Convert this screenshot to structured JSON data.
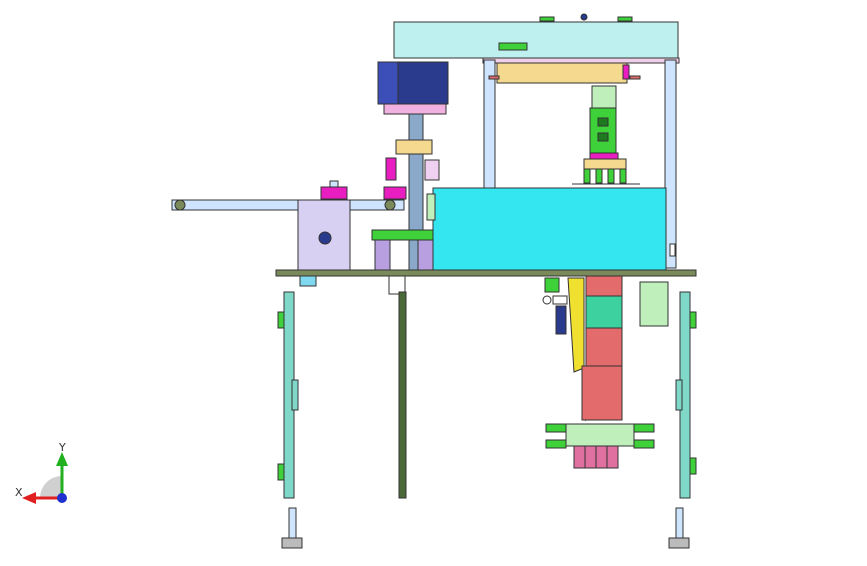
{
  "viewport": {
    "background": "#ffffff",
    "triad": {
      "x_label": "X",
      "y_label": "Y",
      "x_color": "#e02020",
      "y_color": "#20b020",
      "z_color": "#2030d0"
    }
  },
  "colors": {
    "outline": "#333333",
    "cyan_box": "#33e6f0",
    "top_plate": "#bff0f0",
    "tan_plate": "#f5d98e",
    "navy_motor": "#2a3a8c",
    "magenta": "#e91ec0",
    "green": "#3ed13a",
    "salmon": "#e36b6b",
    "lavender": "#d8d0f2",
    "olive_plate": "#7b8a5a",
    "leg_cyan": "#7fd8c8",
    "yellow": "#f0e030",
    "post_blue": "#cfe4ff"
  }
}
